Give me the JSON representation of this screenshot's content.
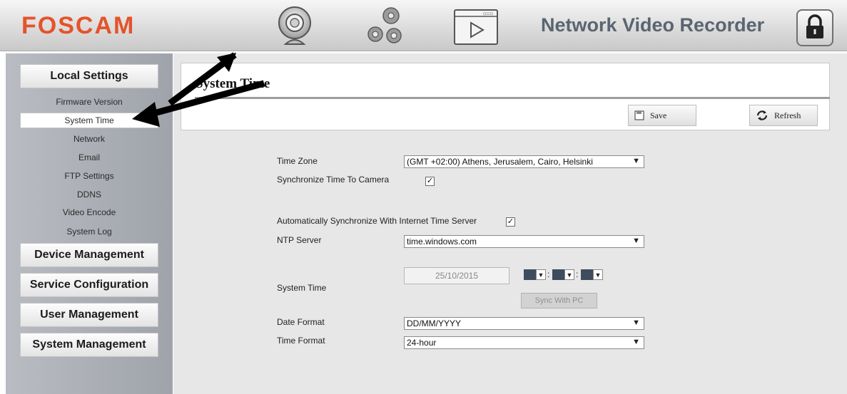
{
  "header": {
    "logo": "FOSCAM",
    "title": "Network Video Recorder",
    "icons": [
      "camera-icon",
      "gears-icon",
      "video-playback-icon",
      "lock-icon"
    ]
  },
  "sidebar": {
    "sections": [
      {
        "label": "Local Settings"
      },
      {
        "label": "Device Management"
      },
      {
        "label": "Service Configuration"
      },
      {
        "label": "User Management"
      },
      {
        "label": "System Management"
      }
    ],
    "local_items": [
      {
        "label": "Firmware Version"
      },
      {
        "label": "System Time",
        "active": true
      },
      {
        "label": "Network"
      },
      {
        "label": "Email"
      },
      {
        "label": "FTP Settings"
      },
      {
        "label": "DDNS"
      },
      {
        "label": "Video Encode"
      },
      {
        "label": "System Log"
      }
    ]
  },
  "main": {
    "title": "System Time",
    "save_label": "Save",
    "refresh_label": "Refresh",
    "form": {
      "time_zone_label": "Time Zone",
      "time_zone_value": "(GMT +02:00) Athens, Jerusalem, Cairo, Helsinki",
      "sync_camera_label": "Synchronize Time To Camera",
      "sync_camera_checked": true,
      "auto_sync_label": "Automatically Synchronize With Internet Time Server",
      "auto_sync_checked": true,
      "ntp_label": "NTP Server",
      "ntp_value": "time.windows.com",
      "system_time_label": "System Time",
      "date_value": "25/10/2015",
      "colon": ":",
      "sync_pc_label": "Sync With PC",
      "date_format_label": "Date Format",
      "date_format_value": "DD/MM/YYYY",
      "time_format_label": "Time Format",
      "time_format_value": "24-hour"
    }
  },
  "colors": {
    "logo": "#e5532b",
    "header_title": "#5a6570",
    "sidebar_bg": "#aeb1b7",
    "content_bg": "#e7e7e7"
  }
}
